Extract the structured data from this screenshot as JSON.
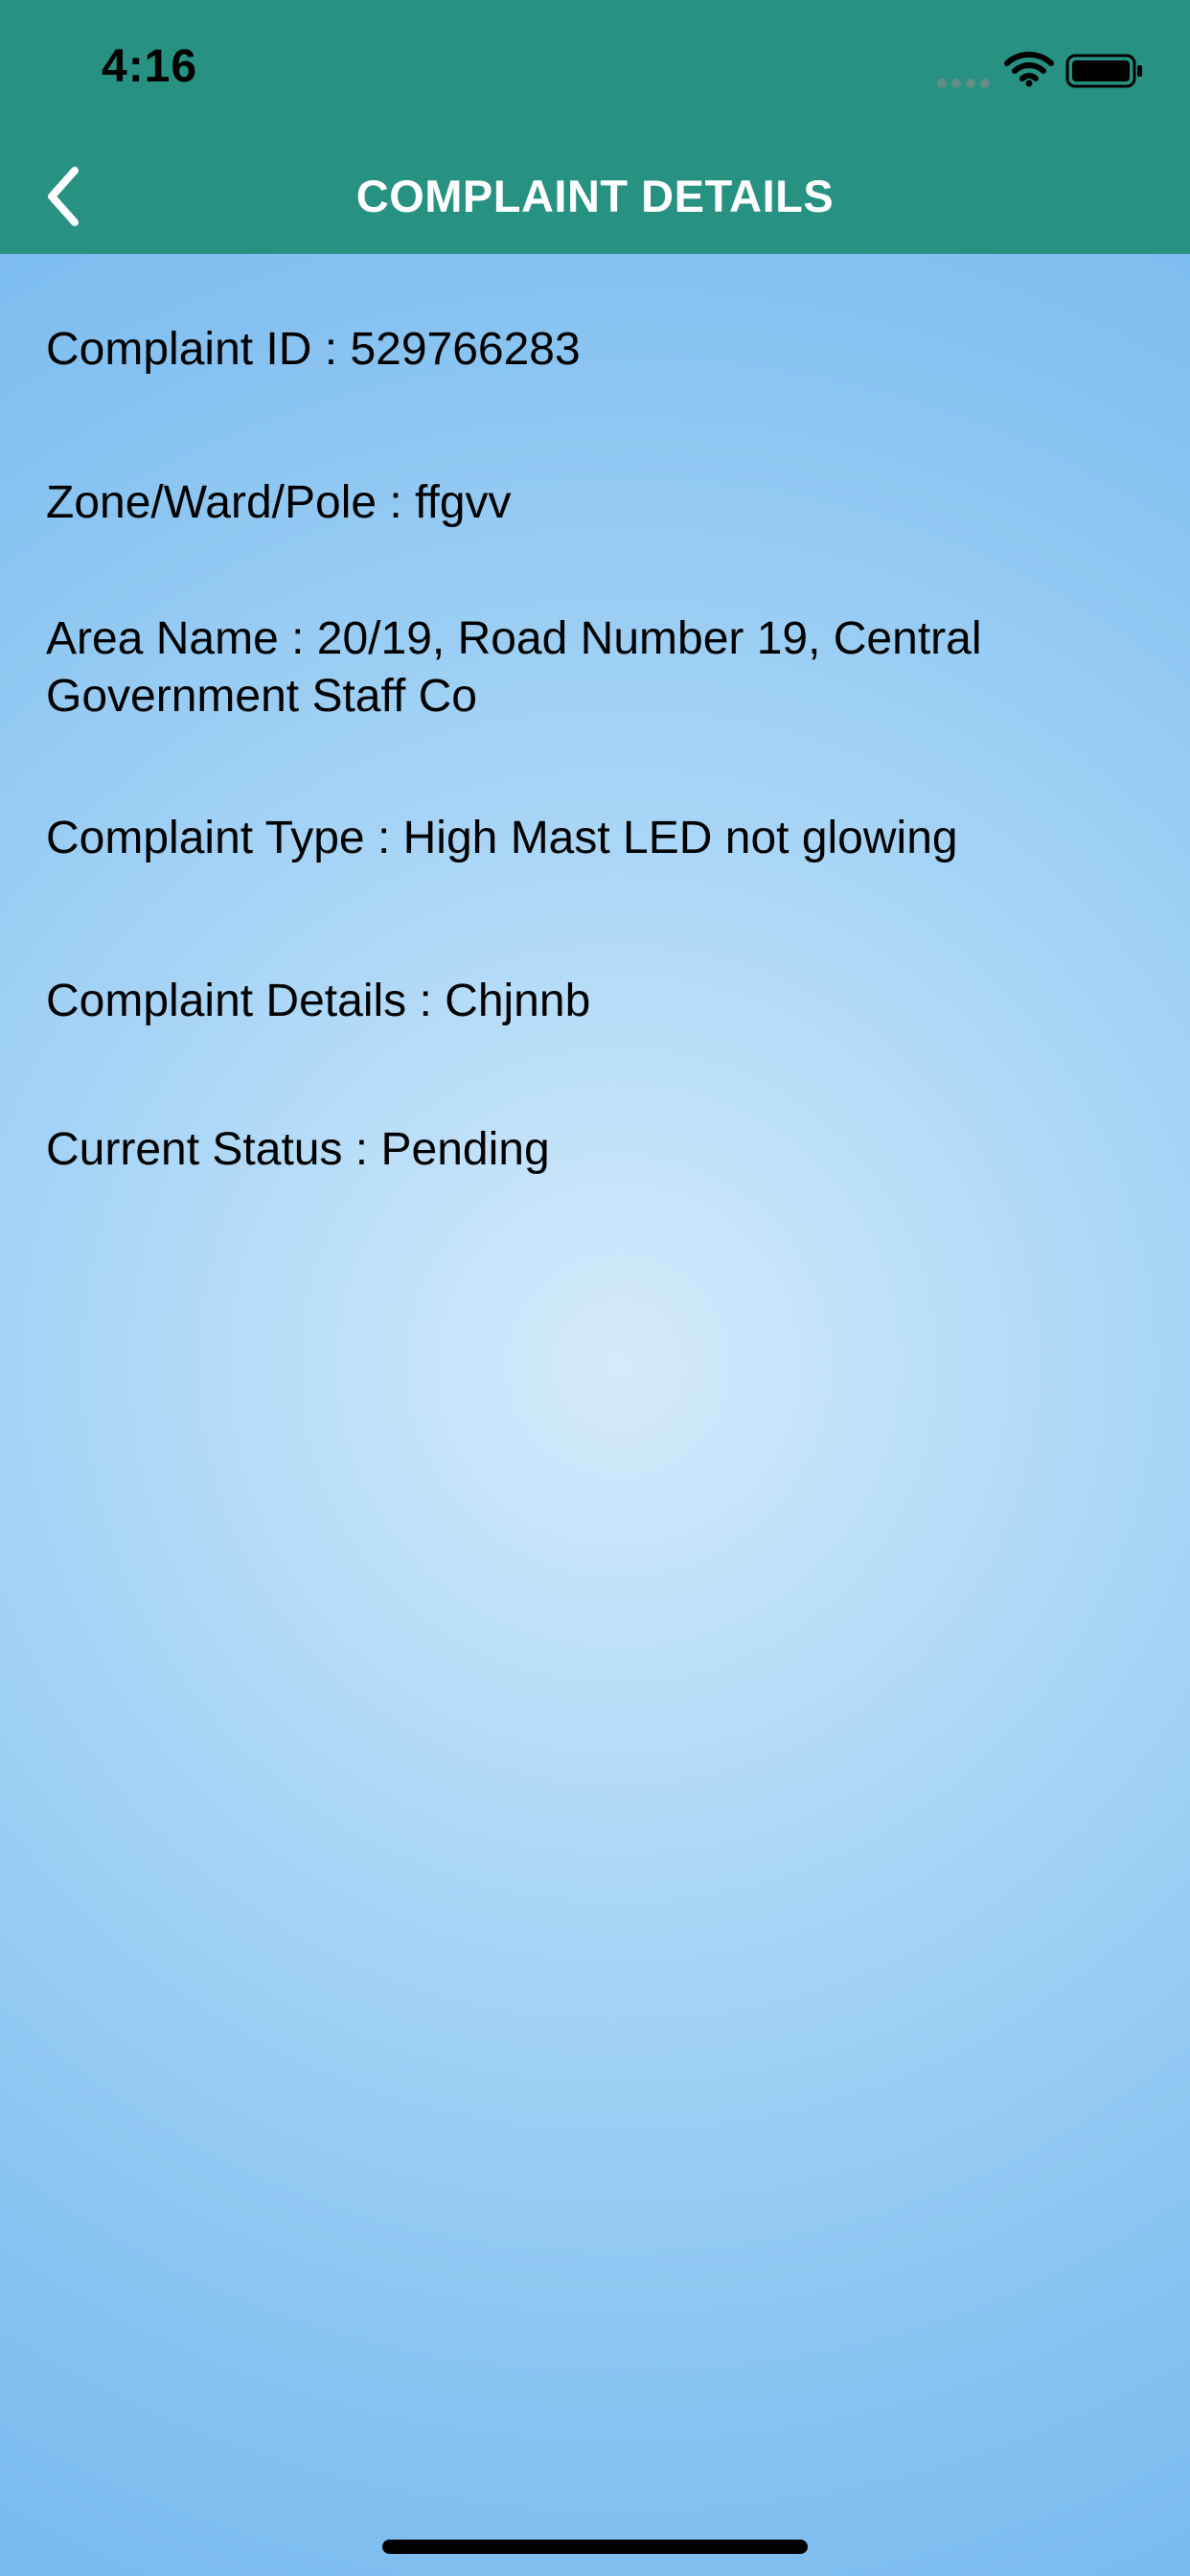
{
  "status_bar": {
    "time": "4:16"
  },
  "nav": {
    "title": "COMPLAINT DETAILS",
    "back_icon": "chevron-left-icon"
  },
  "details": [
    {
      "text": "Complaint ID : 529766283"
    },
    {
      "text": "Zone/Ward/Pole : ffgvv"
    },
    {
      "text": "Area Name : 20/19, Road Number 19, Central Government Staff Co"
    },
    {
      "text": "Complaint Type : High Mast LED not glowing"
    },
    {
      "text": "Complaint Details : Chjnnb"
    },
    {
      "text": "Current Status : Pending"
    }
  ],
  "colors": {
    "header": "#279282",
    "header_text": "#ffffff",
    "background_light": "#d4ebfb",
    "background_dark": "#72b5ef",
    "text": "#000000"
  }
}
